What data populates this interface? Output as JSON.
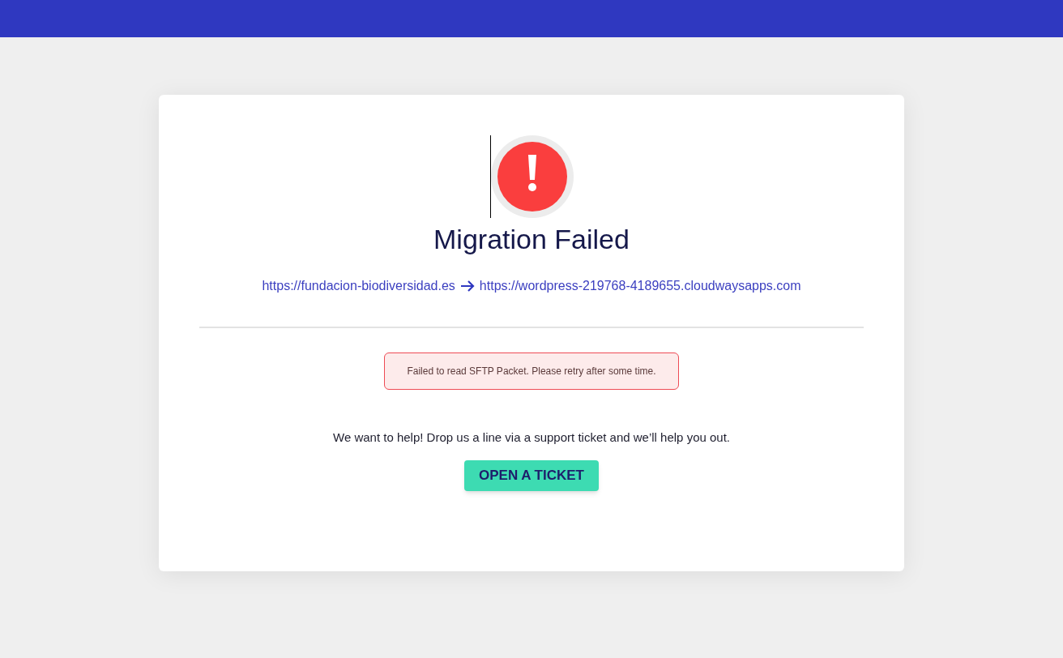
{
  "title": "Migration Failed",
  "source_url": "https://fundacion-biodiversidad.es",
  "destination_url": "https://wordpress-219768-4189655.cloudwaysapps.com",
  "error_message": "Failed to read SFTP Packet. Please retry after some time.",
  "help_text": "We want to help! Drop us a line via a support ticket and we’ll help you out.",
  "button": "OPEN A TICKET"
}
